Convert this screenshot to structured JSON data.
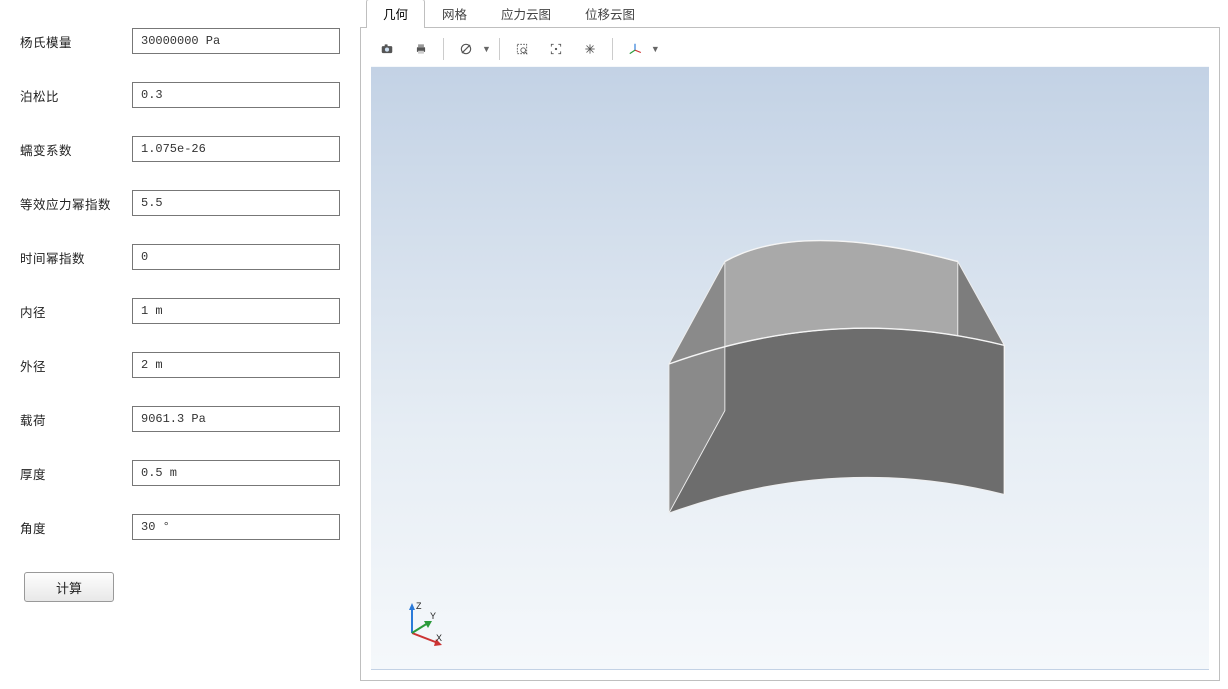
{
  "form": {
    "fields": [
      {
        "label": "杨氏模量",
        "value": "30000000 Pa"
      },
      {
        "label": "泊松比",
        "value": "0.3"
      },
      {
        "label": "蠕变系数",
        "value": "1.075e-26"
      },
      {
        "label": "等效应力幂指数",
        "value": "5.5"
      },
      {
        "label": "时间幂指数",
        "value": "0"
      },
      {
        "label": "内径",
        "value": "1 m"
      },
      {
        "label": "外径",
        "value": "2 m"
      },
      {
        "label": "载荷",
        "value": "9061.3 Pa"
      },
      {
        "label": "厚度",
        "value": "0.5 m"
      },
      {
        "label": "角度",
        "value": "30 °"
      }
    ],
    "calc_label": "计算"
  },
  "tabs": [
    {
      "label": "几何",
      "active": true
    },
    {
      "label": "网格",
      "active": false
    },
    {
      "label": "应力云图",
      "active": false
    },
    {
      "label": "位移云图",
      "active": false
    }
  ],
  "toolbar_icons": [
    "camera-icon",
    "print-icon",
    "sep",
    "mask-icon",
    "sep",
    "zoom-rect-icon",
    "fit-icon",
    "cross-icon",
    "sep",
    "axes-icon"
  ],
  "triad": {
    "x_label": "X",
    "y_label": "Y",
    "z_label": "Z"
  }
}
